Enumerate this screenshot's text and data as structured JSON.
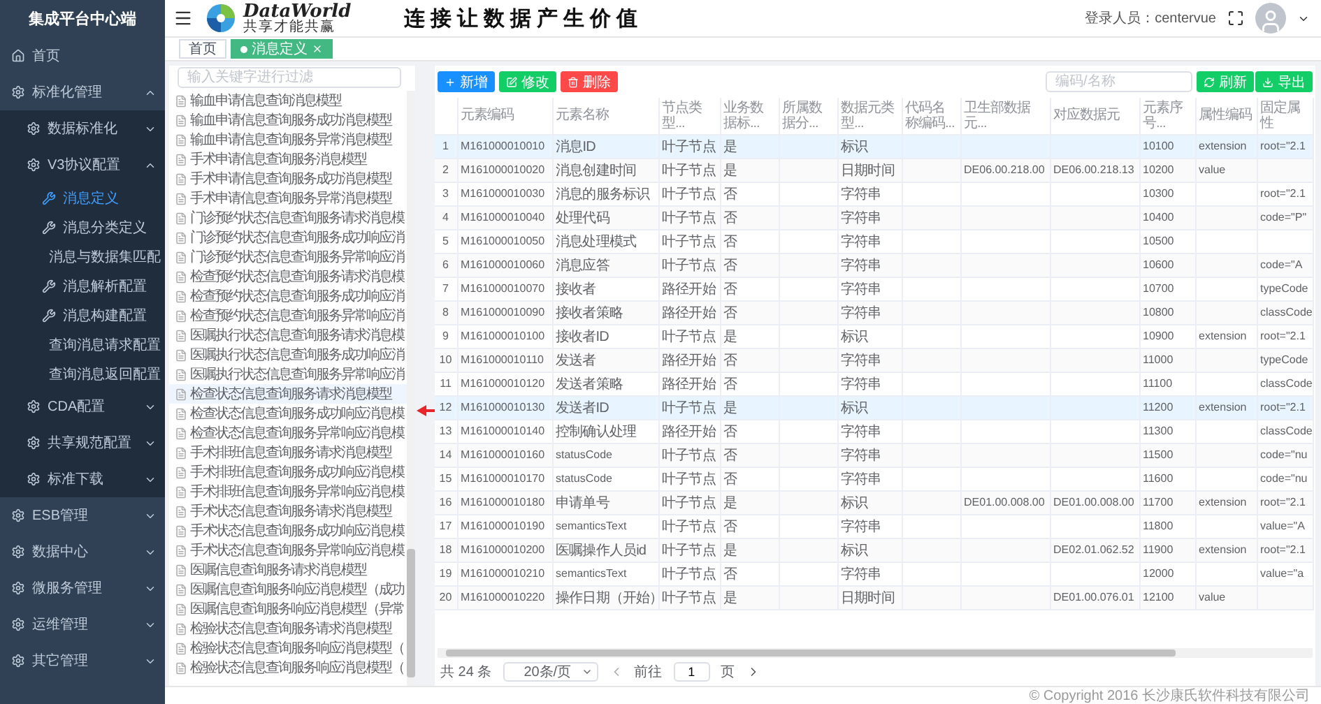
{
  "sidebar": {
    "title": "集成平台中心端",
    "items": [
      {
        "label": "首页",
        "kind": "home"
      },
      {
        "label": "标准化管理",
        "kind": "group",
        "expanded": true,
        "children": [
          {
            "label": "数据标准化",
            "kind": "group",
            "expanded": false
          },
          {
            "label": "V3协议配置",
            "kind": "group",
            "expanded": true,
            "children": [
              {
                "label": "消息定义",
                "kind": "page",
                "selected": true
              },
              {
                "label": "消息分类定义",
                "kind": "page",
                "selected": false
              },
              {
                "label": "消息与数据集匹配",
                "kind": "page",
                "selected": false
              },
              {
                "label": "消息解析配置",
                "kind": "page",
                "selected": false
              },
              {
                "label": "消息构建配置",
                "kind": "page",
                "selected": false
              },
              {
                "label": "查询消息请求配置",
                "kind": "page",
                "selected": false
              },
              {
                "label": "查询消息返回配置",
                "kind": "page",
                "selected": false
              }
            ]
          },
          {
            "label": "CDA配置",
            "kind": "group",
            "expanded": false
          },
          {
            "label": "共享规范配置",
            "kind": "group",
            "expanded": false
          },
          {
            "label": "标准下载",
            "kind": "group",
            "expanded": false
          }
        ]
      },
      {
        "label": "ESB管理",
        "kind": "group",
        "expanded": false
      },
      {
        "label": "数据中心",
        "kind": "group",
        "expanded": false
      },
      {
        "label": "微服务管理",
        "kind": "group",
        "expanded": false
      },
      {
        "label": "运维管理",
        "kind": "group",
        "expanded": false
      },
      {
        "label": "其它管理",
        "kind": "group",
        "expanded": false
      }
    ]
  },
  "header": {
    "logo_text": "DataWorld",
    "logo_tagline": "共享才能共赢",
    "slogan": "连接让数据产生价值",
    "user_label": "登录人员：centervue"
  },
  "tabs": [
    {
      "label": "首页",
      "selected": false,
      "closable": false
    },
    {
      "label": "消息定义",
      "selected": true,
      "closable": true
    }
  ],
  "tree": {
    "placeholder": "输入关键字进行过滤",
    "items": [
      {
        "label": "输血申请信息查询消息模型",
        "selected": false
      },
      {
        "label": "输血申请信息查询服务成功消息模型",
        "selected": false
      },
      {
        "label": "输血申请信息查询服务异常消息模型",
        "selected": false
      },
      {
        "label": "手术申请信息查询服务消息模型",
        "selected": false
      },
      {
        "label": "手术申请信息查询服务成功消息模型",
        "selected": false
      },
      {
        "label": "手术申请信息查询服务异常消息模型",
        "selected": false
      },
      {
        "label": "门诊预约状态信息查询服务请求消息模",
        "selected": false
      },
      {
        "label": "门诊预约状态信息查询服务成功响应消",
        "selected": false
      },
      {
        "label": "门诊预约状态信息查询服务异常响应消",
        "selected": false
      },
      {
        "label": "检查预约状态信息查询服务请求消息模",
        "selected": false
      },
      {
        "label": "检查预约状态信息查询服务成功响应消",
        "selected": false
      },
      {
        "label": "检查预约状态信息查询服务异常响应消",
        "selected": false
      },
      {
        "label": "医嘱执行状态信息查询服务请求消息模",
        "selected": false
      },
      {
        "label": "医嘱执行状态信息查询服务成功响应消",
        "selected": false
      },
      {
        "label": "医嘱执行状态信息查询服务异常响应消",
        "selected": false
      },
      {
        "label": "检查状态信息查询服务请求消息模型",
        "selected": true
      },
      {
        "label": "检查状态信息查询服务成功响应消息模",
        "selected": false
      },
      {
        "label": "检查状态信息查询服务异常响应消息模",
        "selected": false
      },
      {
        "label": "手术排班信息查询服务请求消息模型",
        "selected": false
      },
      {
        "label": "手术排班信息查询服务成功响应消息模",
        "selected": false
      },
      {
        "label": "手术排班信息查询服务异常响应消息模",
        "selected": false
      },
      {
        "label": "手术状态信息查询服务请求消息模型",
        "selected": false
      },
      {
        "label": "手术状态信息查询服务成功响应消息模",
        "selected": false
      },
      {
        "label": "手术状态信息查询服务异常响应消息模",
        "selected": false
      },
      {
        "label": "医嘱信息查询服务请求消息模型",
        "selected": false
      },
      {
        "label": "医嘱信息查询服务响应消息模型（成功",
        "selected": false
      },
      {
        "label": "医嘱信息查询服务响应消息模型（异常",
        "selected": false
      },
      {
        "label": "检验状态信息查询服务请求消息模型",
        "selected": false
      },
      {
        "label": "检验状态信息查询服务响应消息模型（",
        "selected": false
      },
      {
        "label": "检验状态信息查询服务响应消息模型（",
        "selected": false
      }
    ]
  },
  "toolbar": {
    "buttons": [
      {
        "label": "新增",
        "kind": "add"
      },
      {
        "label": "修改",
        "kind": "edit"
      },
      {
        "label": "删除",
        "kind": "delete"
      }
    ],
    "search_placeholder": "编码/名称",
    "actions": [
      {
        "label": "刷新",
        "kind": "refresh"
      },
      {
        "label": "导出",
        "kind": "export"
      }
    ]
  },
  "table": {
    "columns": [
      "元素编码",
      "元素名称",
      "节点类型...",
      "业务数据标...",
      "所属数据分...",
      "数据元类型...",
      "代码名称编码...",
      "卫生部数据元...",
      "对应数据元",
      "元素序号...",
      "属性编码",
      "固定属性"
    ],
    "rows": [
      {
        "index": "1",
        "selected": true,
        "code": "M161000010010",
        "name": "消息ID",
        "node_type": "叶子节点",
        "business_flag": "是",
        "data_type": "标识",
        "seq": "10100",
        "attr_code": "extension",
        "fixed_attr": "root=\"2.1"
      },
      {
        "index": "2",
        "selected": false,
        "code": "M161000010020",
        "name": "消息创建时间",
        "node_type": "叶子节点",
        "business_flag": "是",
        "data_type": "日期时间",
        "moh_element": "DE06.00.218.00",
        "mapped_element": "DE06.00.218.13",
        "seq": "10200",
        "attr_code": "value"
      },
      {
        "index": "3",
        "selected": false,
        "code": "M161000010030",
        "name": "消息的服务标识",
        "node_type": "叶子节点",
        "business_flag": "否",
        "data_type": "字符串",
        "seq": "10300",
        "fixed_attr": "root=\"2.1"
      },
      {
        "index": "4",
        "selected": false,
        "code": "M161000010040",
        "name": "处理代码",
        "node_type": "叶子节点",
        "business_flag": "否",
        "data_type": "字符串",
        "seq": "10400",
        "fixed_attr": "code=\"P\""
      },
      {
        "index": "5",
        "selected": false,
        "code": "M161000010050",
        "name": "消息处理模式",
        "node_type": "叶子节点",
        "business_flag": "否",
        "data_type": "字符串",
        "seq": "10500"
      },
      {
        "index": "6",
        "selected": false,
        "code": "M161000010060",
        "name": "消息应答",
        "node_type": "叶子节点",
        "business_flag": "否",
        "data_type": "字符串",
        "seq": "10600",
        "fixed_attr": "code=\"A"
      },
      {
        "index": "7",
        "selected": false,
        "code": "M161000010070",
        "name": "接收者",
        "node_type": "路径开始",
        "business_flag": "否",
        "data_type": "字符串",
        "seq": "10700",
        "fixed_attr": "typeCode"
      },
      {
        "index": "8",
        "selected": false,
        "code": "M161000010090",
        "name": "接收者策略",
        "node_type": "路径开始",
        "business_flag": "否",
        "data_type": "字符串",
        "seq": "10800",
        "fixed_attr": "classCode"
      },
      {
        "index": "9",
        "selected": false,
        "code": "M161000010100",
        "name": "接收者ID",
        "node_type": "叶子节点",
        "business_flag": "是",
        "data_type": "标识",
        "seq": "10900",
        "attr_code": "extension",
        "fixed_attr": "root=\"2.1"
      },
      {
        "index": "10",
        "selected": false,
        "code": "M161000010110",
        "name": "发送者",
        "node_type": "路径开始",
        "business_flag": "否",
        "data_type": "字符串",
        "seq": "11000",
        "fixed_attr": "typeCode"
      },
      {
        "index": "11",
        "selected": false,
        "code": "M161000010120",
        "name": "发送者策略",
        "node_type": "路径开始",
        "business_flag": "否",
        "data_type": "字符串",
        "seq": "11100",
        "fixed_attr": "classCode"
      },
      {
        "index": "12",
        "selected": true,
        "code": "M161000010130",
        "name": "发送者ID",
        "node_type": "叶子节点",
        "business_flag": "是",
        "data_type": "标识",
        "seq": "11200",
        "attr_code": "extension",
        "fixed_attr": "root=\"2.1"
      },
      {
        "index": "13",
        "selected": false,
        "code": "M161000010140",
        "name": "控制确认处理",
        "node_type": "路径开始",
        "business_flag": "否",
        "data_type": "字符串",
        "seq": "11300",
        "fixed_attr": "classCode"
      },
      {
        "index": "14",
        "selected": false,
        "code": "M161000010160",
        "name": "statusCode",
        "node_type": "叶子节点",
        "business_flag": "否",
        "data_type": "字符串",
        "seq": "11500",
        "fixed_attr": "code=\"nu"
      },
      {
        "index": "15",
        "selected": false,
        "code": "M161000010170",
        "name": "statusCode",
        "node_type": "叶子节点",
        "business_flag": "否",
        "data_type": "字符串",
        "seq": "11600",
        "fixed_attr": "code=\"nu"
      },
      {
        "index": "16",
        "selected": false,
        "code": "M161000010180",
        "name": "申请单号",
        "node_type": "叶子节点",
        "business_flag": "是",
        "data_type": "标识",
        "moh_element": "DE01.00.008.00",
        "mapped_element": "DE01.00.008.00",
        "seq": "11700",
        "attr_code": "extension",
        "fixed_attr": "root=\"2.1"
      },
      {
        "index": "17",
        "selected": false,
        "code": "M161000010190",
        "name": "semanticsText",
        "node_type": "叶子节点",
        "business_flag": "否",
        "data_type": "字符串",
        "seq": "11800",
        "fixed_attr": "value=\"A"
      },
      {
        "index": "18",
        "selected": false,
        "code": "M161000010200",
        "name": "医嘱操作人员id",
        "node_type": "叶子节点",
        "business_flag": "是",
        "data_type": "标识",
        "mapped_element": "DE02.01.062.52",
        "seq": "11900",
        "attr_code": "extension",
        "fixed_attr": "root=\"2.1"
      },
      {
        "index": "19",
        "selected": false,
        "code": "M161000010210",
        "name": "semanticsText",
        "node_type": "叶子节点",
        "business_flag": "否",
        "data_type": "字符串",
        "seq": "12000",
        "fixed_attr": "value=\"a"
      },
      {
        "index": "20",
        "selected": false,
        "code": "M161000010220",
        "name": "操作日期（开始）",
        "node_type": "叶子节点",
        "business_flag": "是",
        "data_type": "日期时间",
        "mapped_element": "DE01.00.076.01",
        "seq": "12100",
        "attr_code": "value"
      }
    ]
  },
  "pagination": {
    "total": "共 24 条",
    "page_size": "20条/页",
    "goto_label": "前往",
    "page": "1",
    "page_suffix": "页"
  },
  "footer": "© Copyright 2016 长沙康氏软件科技有限公司"
}
